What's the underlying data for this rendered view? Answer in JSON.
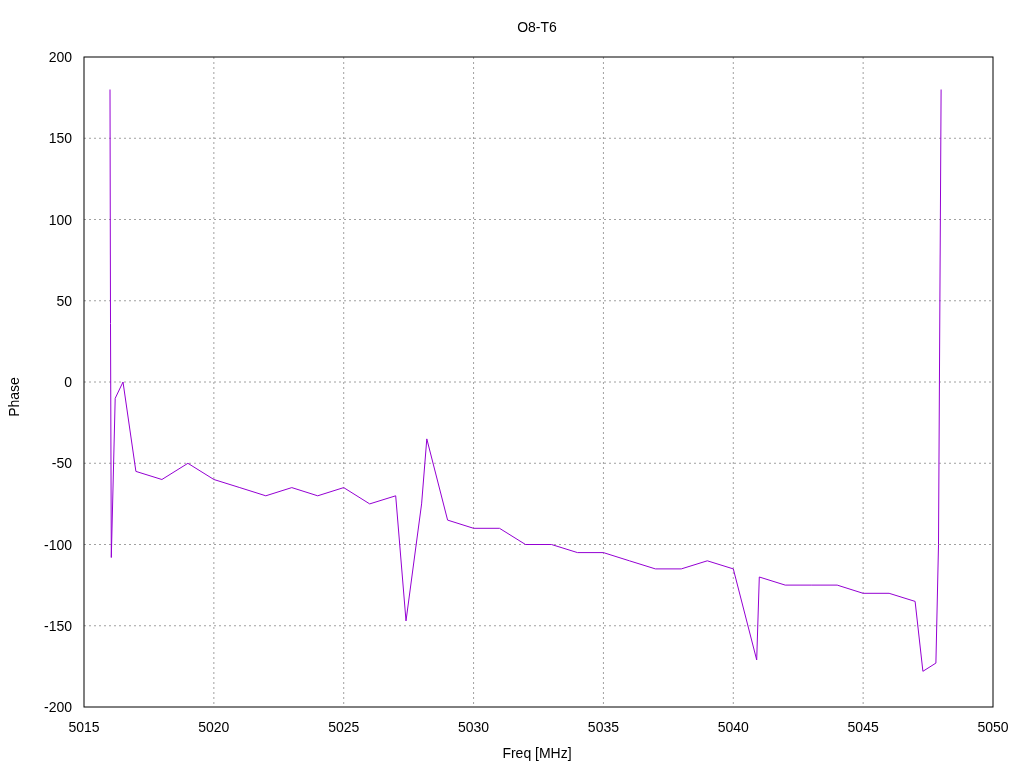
{
  "plot": {
    "chart_data": {
      "type": "line",
      "title": "O8-T6",
      "xlabel": "Freq [MHz]",
      "ylabel": "Phase",
      "xlim": [
        5015,
        5050
      ],
      "ylim": [
        -200,
        200
      ],
      "xticks": [
        5015,
        5020,
        5025,
        5030,
        5035,
        5040,
        5045,
        5050
      ],
      "yticks": [
        -200,
        -150,
        -100,
        -50,
        0,
        50,
        100,
        150,
        200
      ],
      "x": [
        5016.0,
        5016.02,
        5016.05,
        5016.2,
        5016.5,
        5017,
        5018,
        5019,
        5020,
        5021,
        5022,
        5023,
        5024,
        5025,
        5026,
        5027,
        5027.4,
        5028,
        5028.2,
        5029,
        5030,
        5031,
        5032,
        5033,
        5034,
        5035,
        5036,
        5037,
        5038,
        5039,
        5040,
        5040.9,
        5041,
        5042,
        5043,
        5044,
        5045,
        5046,
        5047,
        5047.3,
        5047.8,
        5047.9,
        5048.0
      ],
      "grid": true,
      "series": [
        {
          "color": "#9400d3",
          "values": [
            180,
            36,
            -108,
            -10,
            0,
            -55,
            -60,
            -50,
            -60,
            -65,
            -70,
            -65,
            -70,
            -65,
            -75,
            -70,
            -147,
            -75,
            -35,
            -85,
            -90,
            -90,
            -100,
            -100,
            -105,
            -105,
            -110,
            -115,
            -115,
            -110,
            -115,
            -171,
            -120,
            -125,
            -125,
            -125,
            -130,
            -130,
            -135,
            -178,
            -173,
            -100,
            180
          ]
        }
      ]
    }
  }
}
